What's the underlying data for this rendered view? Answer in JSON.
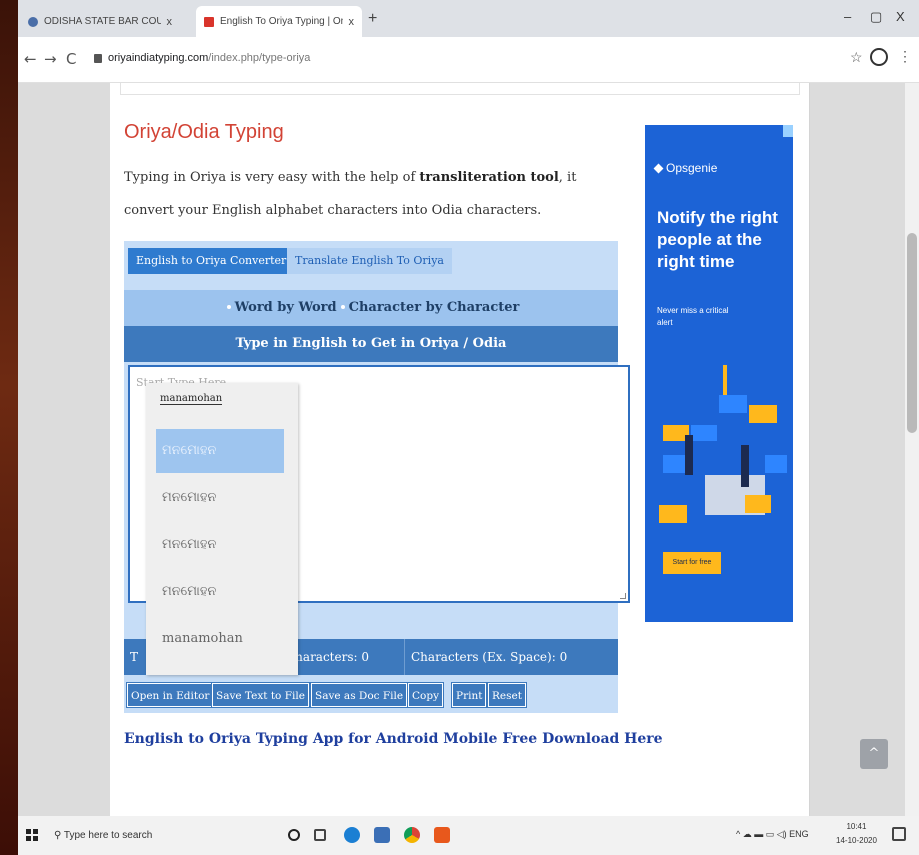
{
  "tabs": [
    {
      "title": "ODISHA STATE BAR COUNCIL",
      "close": "x"
    },
    {
      "title": "English To Oriya Typing | Online",
      "close": "x"
    }
  ],
  "new_tab": "+",
  "window_controls": {
    "minimize": "–",
    "maximize": "▢",
    "close": "X"
  },
  "nav": {
    "back": "←",
    "forward": "→",
    "reload": "C"
  },
  "address": {
    "domain": "oriyaindiatyping.com",
    "path": "/index.php/type-oriya"
  },
  "page": {
    "heading": "Oriya/Odia Typing",
    "intro_before": "Typing in Oriya is very easy with the help of ",
    "intro_bold": "transliteration tool",
    "intro_after": ", it convert your English alphabet characters into Odia characters."
  },
  "tool": {
    "tab_active": "English to Oriya Converter",
    "tab_inactive": "Translate English To Oriya",
    "mode_word": "Word by Word",
    "mode_char": "Character by Character",
    "header": "Type in English to Get in Oriya / Odia",
    "placeholder": "Start Type Here",
    "stats_total_prefix": "T",
    "stats_characters": "Characters: 0",
    "stats_characters_ex": "Characters (Ex. Space): 0",
    "buttons": [
      "Open in Editor",
      "Save Text to File",
      "Save as Doc File",
      "Copy",
      "Print",
      "Reset"
    ]
  },
  "suggestions": {
    "typed": "manamohan",
    "items": [
      "ମନମୋହନ",
      "ମନମୋହନ",
      "ମନମୋହନ",
      "ମନମୋହନ",
      "manamohan"
    ],
    "selected_index": 0
  },
  "app_link": "English to Oriya Typing App for Android Mobile Free Download Here",
  "ad": {
    "brand": "Opsgenie",
    "headline": "Notify the right people at the right time",
    "sub": "Never miss a critical alert",
    "cta": "Start for free",
    "colors": {
      "background": "#1c63d6",
      "accent": "#ffb81c"
    }
  },
  "taskbar": {
    "search_placeholder": "Type here to search",
    "tray_text": "^ ☁ ▬ ▭ ◁) ENG",
    "time": "10:41",
    "date": "14-10-2020"
  }
}
